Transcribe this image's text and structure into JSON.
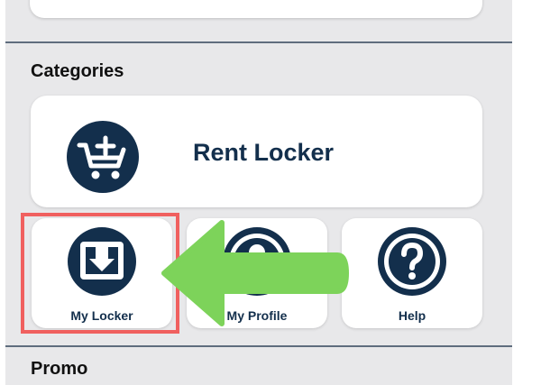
{
  "sections": {
    "categories_title": "Categories",
    "promo_title": "Promo"
  },
  "categories": {
    "rent_locker": {
      "label": "Rent Locker",
      "icon": "cart-plus-icon"
    },
    "items": [
      {
        "label": "My Locker",
        "icon": "inbox-download-icon"
      },
      {
        "label": "My Profile",
        "icon": "profile-icon"
      },
      {
        "label": "Help",
        "icon": "help-question-icon"
      }
    ]
  },
  "annotation": {
    "highlight_color": "#f0605f",
    "arrow_color": "#7dd35a",
    "target": "My Locker"
  },
  "colors": {
    "primary": "#132f4c",
    "background": "#e8e8ea",
    "card": "#ffffff"
  }
}
